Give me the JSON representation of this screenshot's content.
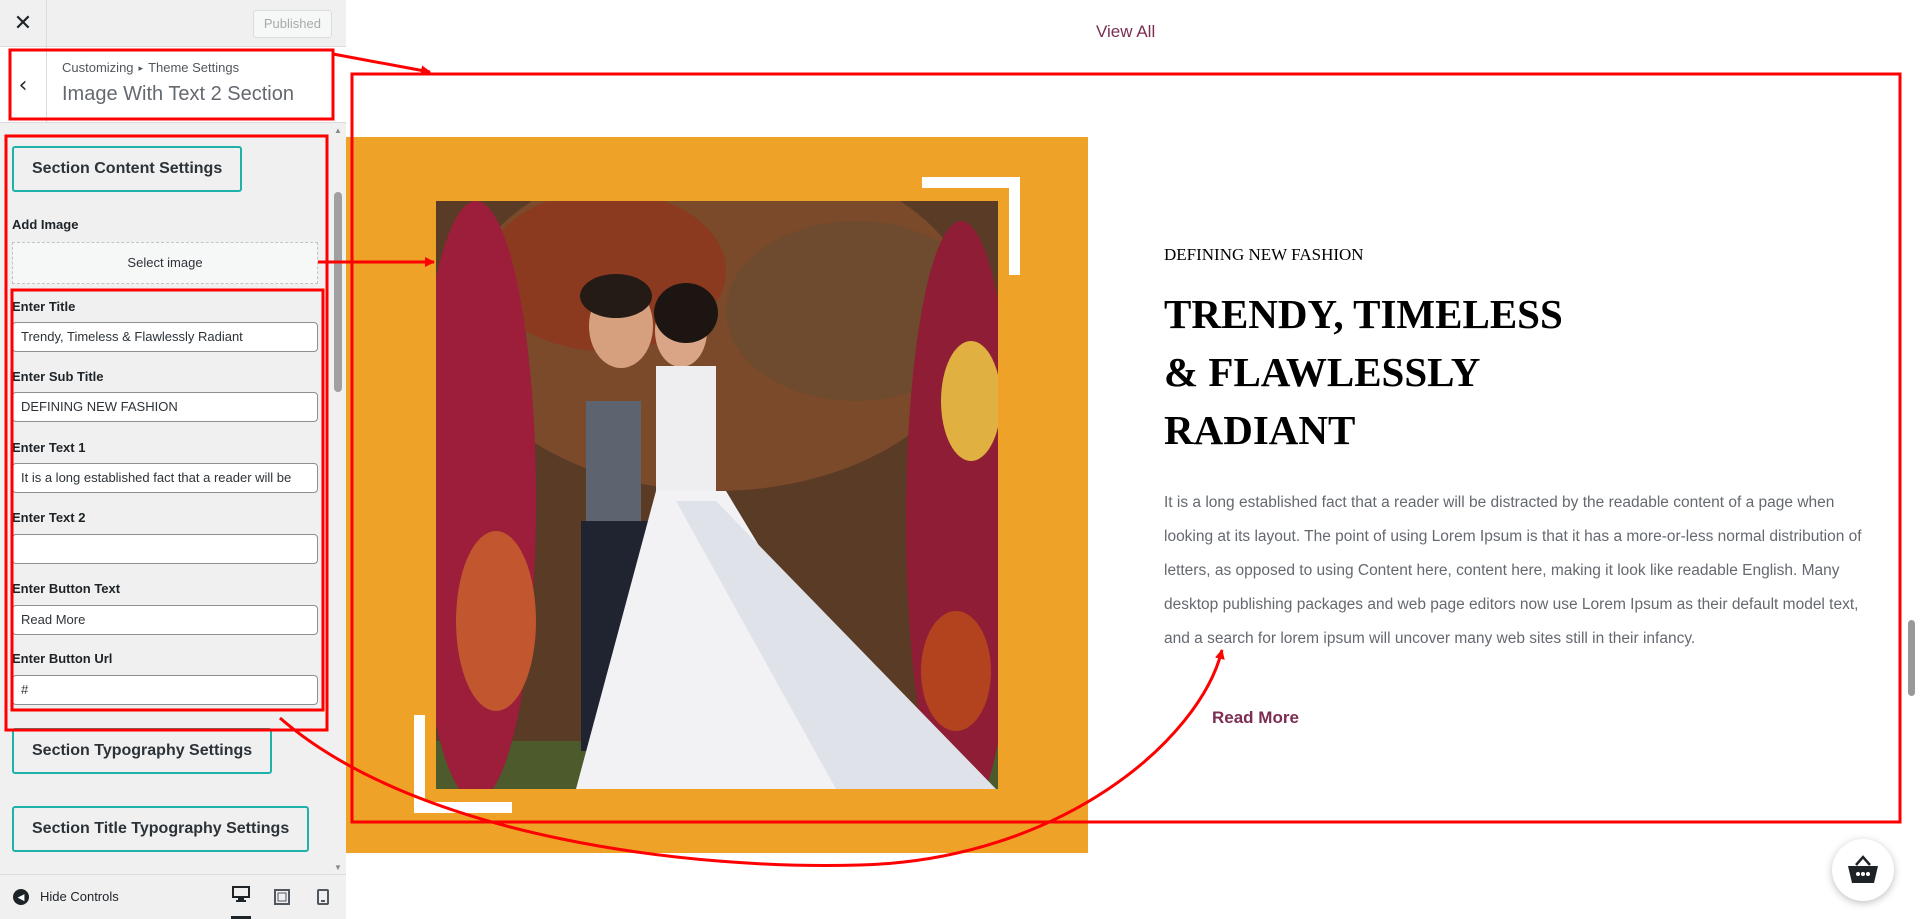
{
  "topbar": {
    "close_icon": "close-icon",
    "publish_label": "Published"
  },
  "section_header": {
    "back_icon": "chevron-left-icon",
    "breadcrumb_root": "Customizing",
    "breadcrumb_separator": "▸",
    "breadcrumb_parent": "Theme Settings",
    "title": "Image With Text 2 Section"
  },
  "panel": {
    "content_settings_label": "Section Content Settings",
    "add_image_label": "Add Image",
    "select_image_label": "Select image",
    "fields": [
      {
        "label": "Enter Title",
        "value": "Trendy, Timeless & Flawlessly Radiant"
      },
      {
        "label": "Enter Sub Title",
        "value": "DEFINING NEW FASHION"
      },
      {
        "label": "Enter Text 1",
        "value": "It is a long established fact that a reader will be"
      },
      {
        "label": "Enter Text 2",
        "value": ""
      },
      {
        "label": "Enter Button Text",
        "value": "Read More"
      },
      {
        "label": "Enter Button Url",
        "value": "#"
      }
    ],
    "typography_settings_label": "Section Typography Settings",
    "title_typography_settings_label": "Section Title Typography Settings"
  },
  "footer": {
    "hide_controls_label": "Hide Controls",
    "hide_icon": "arrow-left-circle-icon",
    "devices": [
      "desktop-icon",
      "tablet-icon",
      "mobile-icon"
    ]
  },
  "preview": {
    "view_all_label": "View All",
    "subtitle": "DEFINING NEW FASHION",
    "title_lines": [
      "TRENDY, TIMELESS",
      "& FLAWLESSLY",
      "RADIANT"
    ],
    "body_lines": [
      "It is a long established fact that a reader will be distracted by the readable content of a page when",
      "looking at its layout. The point of using Lorem Ipsum is that it has a more-or-less normal distribution of",
      "letters, as opposed to using Content here, content here, making it look like readable English. Many",
      "desktop publishing packages and web page editors now use Lorem Ipsum as their default model text,",
      "and a search for lorem ipsum will uncover many web sites still in their infancy."
    ],
    "read_more_label": "Read More",
    "cart_icon": "basket-icon"
  },
  "colors": {
    "accent_teal": "#20b2aa",
    "image_block_orange": "#eea227",
    "link_plum": "#7b2d52",
    "annotation_red": "#ff0000"
  }
}
